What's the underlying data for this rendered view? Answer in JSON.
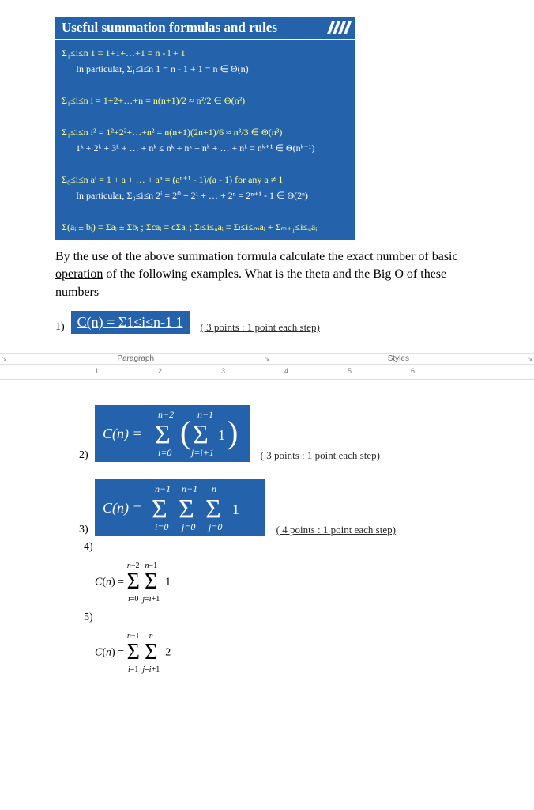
{
  "header": {
    "title": "Useful summation formulas and rules"
  },
  "formulas": {
    "f1": "Σ₁≤i≤n 1 = 1+1+…+1 = n - l + 1",
    "f1b": "In particular, Σ₁≤i≤n 1 = n - 1 + 1 = n ∈ Θ(n)",
    "f2": "Σ₁≤i≤n i = 1+2+…+n = n(n+1)/2 ≈ n²/2 ∈ Θ(n²)",
    "f3": "Σ₁≤i≤n i² = 1²+2²+…+n² = n(n+1)(2n+1)/6 ≈ n³/3 ∈ Θ(n³)",
    "f3b": "1ᵏ + 2ᵏ + 3ᵏ + … + nᵏ ≤ nᵏ + nᵏ + nᵏ + … + nᵏ = nᵏ⁺¹ ∈ Θ(nᵏ⁺¹)",
    "f4": "Σ₀≤i≤n aⁱ = 1 + a + … + aⁿ = (aⁿ⁺¹ - 1)/(a - 1)  for any a ≠ 1",
    "f4b": "In particular, Σ₀≤i≤n 2ⁱ = 2⁰ + 2¹ + … + 2ⁿ = 2ⁿ⁺¹ - 1 ∈ Θ(2ⁿ)",
    "f5": "Σ(aᵢ ± bᵢ) = Σaᵢ ± Σbᵢ ;   Σcaᵢ = cΣaᵢ ;   Σₗ≤i≤ᵤaᵢ = Σₗ≤i≤ₘaᵢ + Σₘ₊₁≤i≤ᵤaᵢ"
  },
  "prompt": {
    "line1": "By the use of the above summation formula calculate the exact number of basic ",
    "underlined": "operation",
    "line2": " of the following examples. What is the theta and the Big O of these numbers"
  },
  "questions": {
    "q1": {
      "num": "1)",
      "formula_text": "C(n) = Σ1≤i≤n-1 1",
      "points": "( 3 points : 1 point each step)"
    },
    "q2": {
      "num": "2)",
      "points": "( 3 points : 1 point each step)"
    },
    "q3": {
      "num": "3)",
      "points": "( 4 points : 1 point each step)"
    },
    "q4": {
      "num": "4)"
    },
    "q5": {
      "num": "5)"
    }
  },
  "ribbon": {
    "group1": "Paragraph",
    "group2": "Styles"
  },
  "ruler": {
    "marks": [
      "1",
      "2",
      "3",
      "4",
      "5",
      "6"
    ]
  },
  "chart_data": {
    "type": "table",
    "title": "Summation problems",
    "rows": [
      {
        "id": 1,
        "formula": "C(n) = Σ_{1≤i≤n-1} 1",
        "points": 3,
        "per_step": 1
      },
      {
        "id": 2,
        "formula": "C(n) = Σ_{i=0}^{n-2} ( Σ_{j=i+1}^{n-1} 1 )",
        "points": 3,
        "per_step": 1
      },
      {
        "id": 3,
        "formula": "C(n) = Σ_{i=0}^{n-1} Σ_{j=0}^{n-1} Σ_{j=0}^{n} 1",
        "points": 4,
        "per_step": 1
      },
      {
        "id": 4,
        "formula": "C(n) = Σ_{i=0}^{n-2} Σ_{j=i+1}^{n-1} 1"
      },
      {
        "id": 5,
        "formula": "C(n) = Σ_{i=1}^{n-1} Σ_{j=i+1}^{n} 2"
      }
    ]
  }
}
